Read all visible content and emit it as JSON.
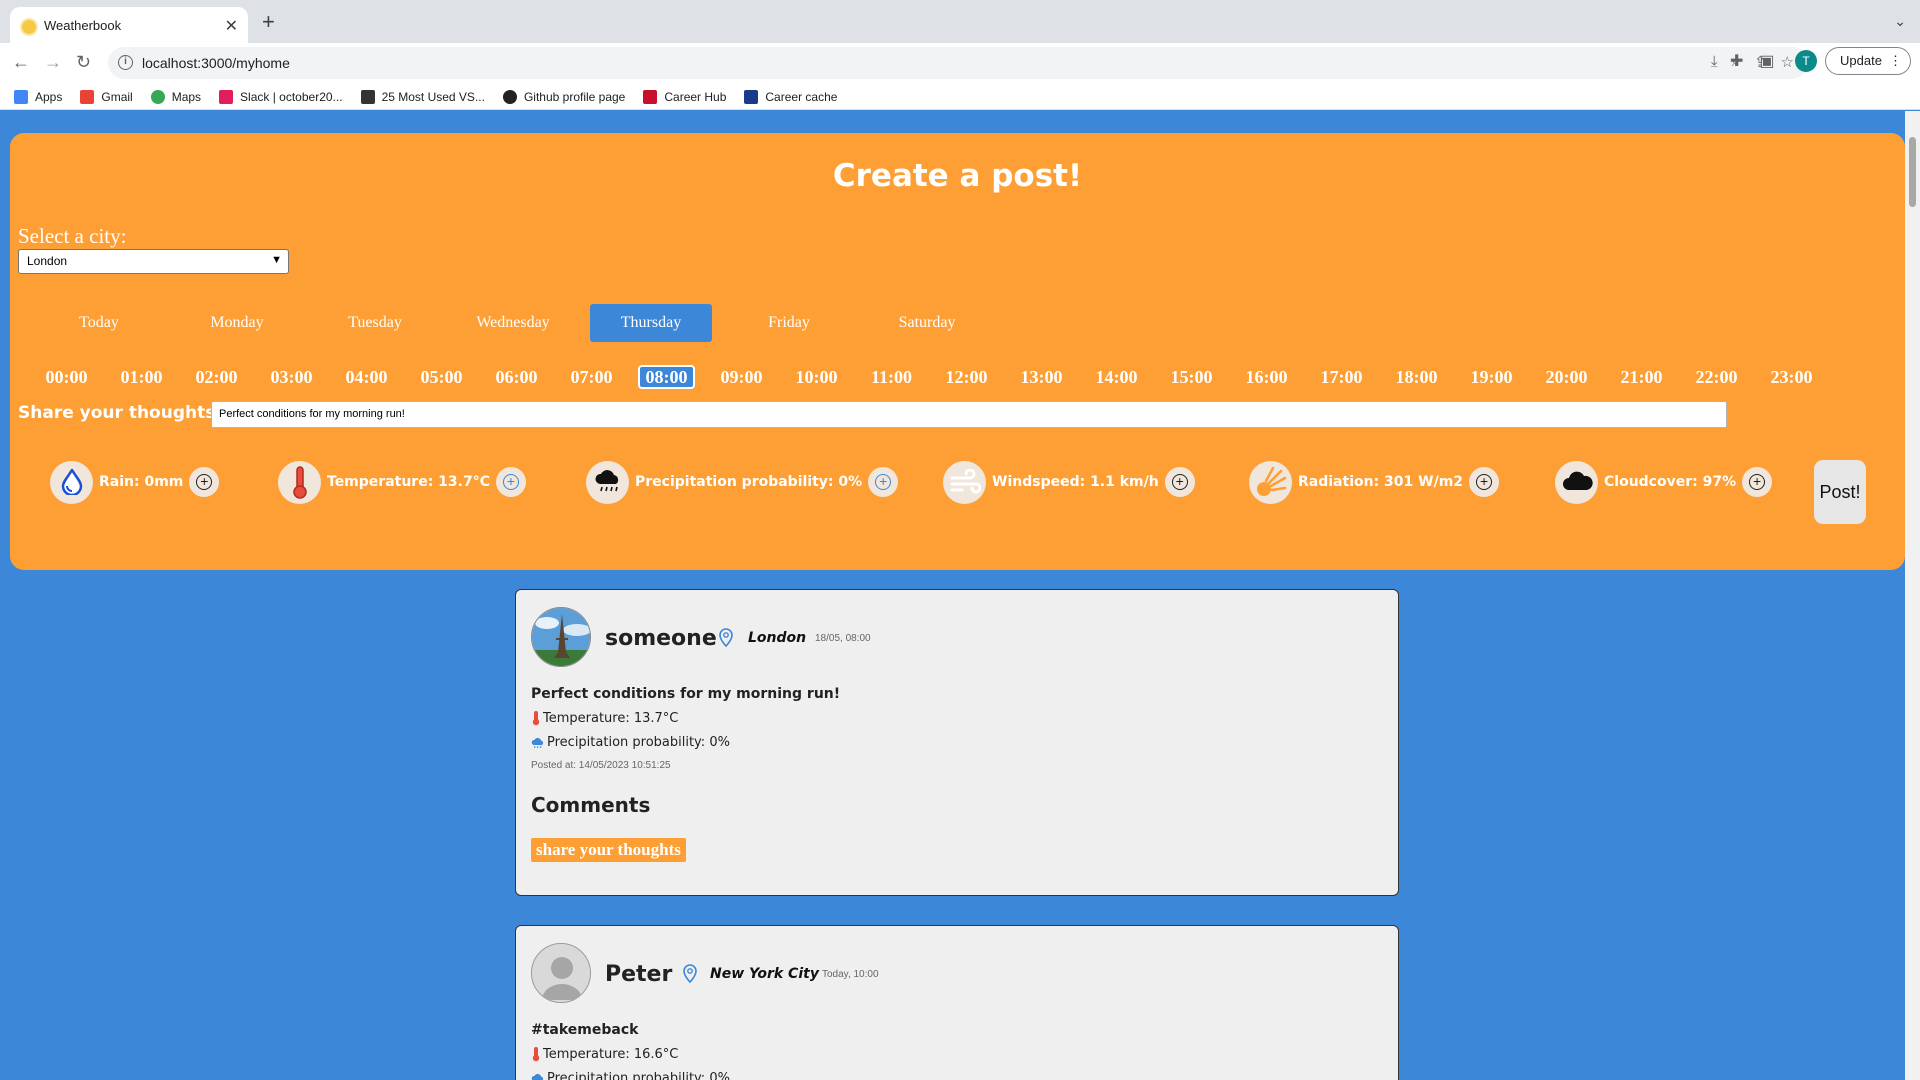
{
  "browser": {
    "tab_title": "Weatherbook",
    "url": "localhost:3000/myhome",
    "profile_initial": "T",
    "update_label": "Update",
    "bookmarks": [
      {
        "label": "Apps",
        "color": "#4285f4"
      },
      {
        "label": "Gmail",
        "color": "#ea4335"
      },
      {
        "label": "Maps",
        "color": "#34a853"
      },
      {
        "label": "Slack | october20...",
        "color": "#e01e5a"
      },
      {
        "label": "25 Most Used VS...",
        "color": "#333333"
      },
      {
        "label": "Github profile page",
        "color": "#222222"
      },
      {
        "label": "Career Hub",
        "color": "#c8102e"
      },
      {
        "label": "Career cache",
        "color": "#1a3a8a"
      }
    ]
  },
  "create": {
    "title": "Create a post!",
    "city_label": "Select a city:",
    "city_value": "London",
    "days": [
      "Today",
      "Monday",
      "Tuesday",
      "Wednesday",
      "Thursday",
      "Friday",
      "Saturday"
    ],
    "active_day": "Thursday",
    "hours": [
      "00:00",
      "01:00",
      "02:00",
      "03:00",
      "04:00",
      "05:00",
      "06:00",
      "07:00",
      "08:00",
      "09:00",
      "10:00",
      "11:00",
      "12:00",
      "13:00",
      "14:00",
      "15:00",
      "16:00",
      "17:00",
      "18:00",
      "19:00",
      "20:00",
      "21:00",
      "22:00",
      "23:00"
    ],
    "active_hour": "08:00",
    "thoughts_label": "Share your thoughts:",
    "thoughts_value": "Perfect conditions for my morning run!",
    "metrics": [
      {
        "icon": "raindrop-icon",
        "label": "Rain: 0mm",
        "add_style": "dark"
      },
      {
        "icon": "thermometer-icon",
        "label": "Temperature: 13.7°C",
        "add_style": "blue"
      },
      {
        "icon": "rain-cloud-icon",
        "label": "Precipitation probability: 0%",
        "add_style": "blue"
      },
      {
        "icon": "wind-icon",
        "label": "Windspeed: 1.1 km/h",
        "add_style": "dark"
      },
      {
        "icon": "sun-radiation-icon",
        "label": "Radiation: 301 W/m2",
        "add_style": "dark"
      },
      {
        "icon": "cloud-icon",
        "label": "Cloudcover: 97%",
        "add_style": "dark"
      }
    ],
    "post_label": "Post!"
  },
  "feed": [
    {
      "user": "someone",
      "city": "London",
      "when": "18/05, 08:00",
      "text": "Perfect conditions for my morning run!",
      "temperature": "Temperature: 13.7°C",
      "precipitation": "Precipitation probability: 0%",
      "posted_at": "Posted at: 14/05/2023 10:51:25",
      "comments_title": "Comments",
      "share_label": "share your thoughts"
    },
    {
      "user": "Peter",
      "city": "New York City",
      "when": "Today, 10:00",
      "text": "#takemeback",
      "temperature": "Temperature: 16.6°C",
      "precipitation": "Precipitation probability: 0%"
    }
  ],
  "colors": {
    "page_bg": "#3d87d9",
    "panel": "#fe9f35",
    "card": "#efefef"
  }
}
